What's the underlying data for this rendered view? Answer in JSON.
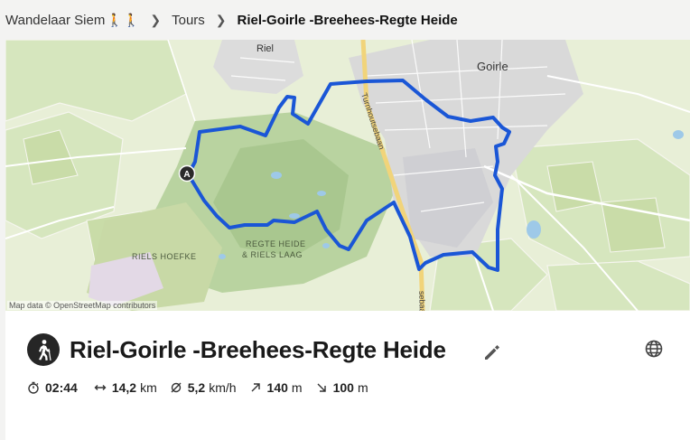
{
  "breadcrumb": {
    "user": "Wandelaar Siem",
    "section": "Tours",
    "current": "Riel-Goirle -Breehees-Regte Heide"
  },
  "map": {
    "labels": {
      "riel": "Riel",
      "goirle": "Goirle",
      "road": "Turnhoutsebaan",
      "road_south": "sebaan",
      "regte_heide_1": "REGTE HEIDE",
      "regte_heide_2": "& RIELS LAAG",
      "riels_hoefke": "RIELS HOEFKE",
      "start_marker": "A"
    },
    "attribution": "Map data © OpenStreetMap contributors",
    "route_color": "#1a56d6"
  },
  "tour": {
    "title": "Riel-Goirle -Breehees-Regte Heide",
    "sport_icon": "hiking-icon",
    "stats": {
      "duration": "02:44",
      "distance_value": "14,2",
      "distance_unit": "km",
      "speed_value": "5,2",
      "speed_unit": "km/h",
      "uphill_value": "140",
      "uphill_unit": "m",
      "downhill_value": "100",
      "downhill_unit": "m"
    }
  }
}
